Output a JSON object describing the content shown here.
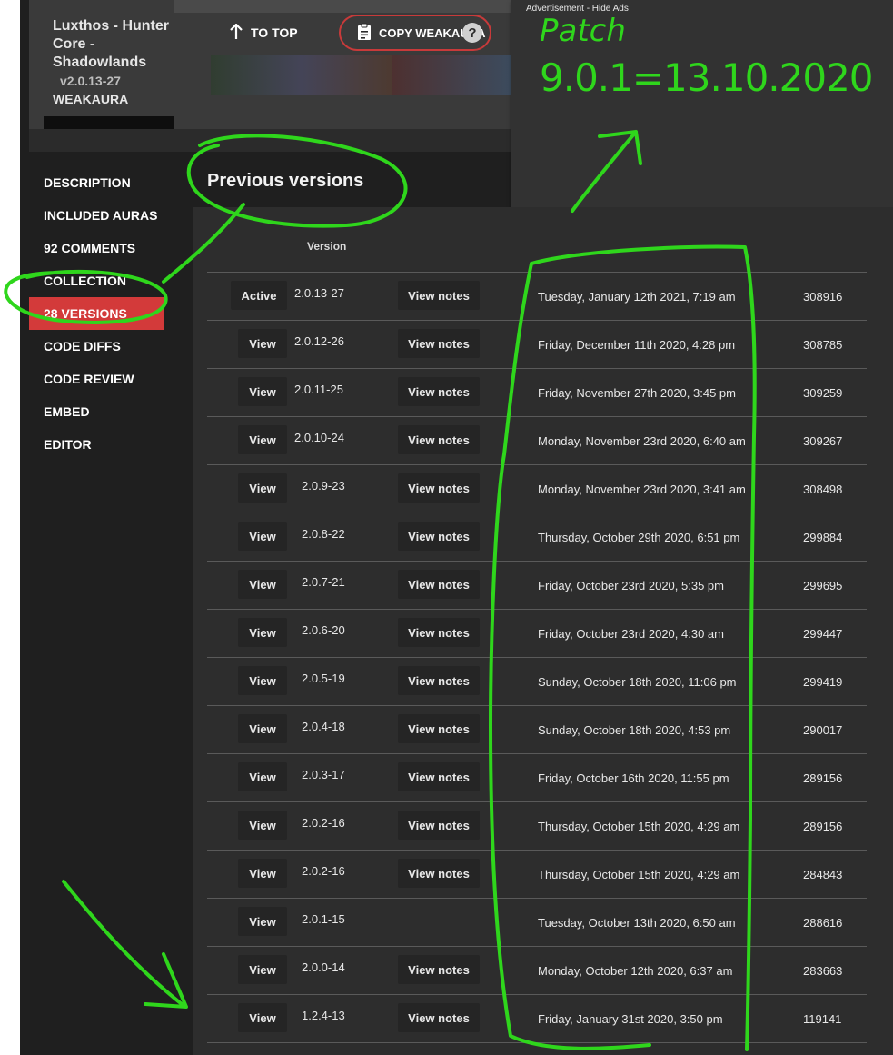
{
  "header": {
    "aura_title": "Luxthos - Hunter Core - Shadowlands",
    "aura_version": "v2.0.13-27",
    "aura_type": "WEAKAURA",
    "to_top_label": "TO TOP",
    "copy_label": "COPY WEAKAURA",
    "help_glyph": "?"
  },
  "ad": {
    "label": "Advertisement - Hide Ads"
  },
  "sidebar": {
    "items": [
      {
        "label": "DESCRIPTION"
      },
      {
        "label": "INCLUDED AURAS"
      },
      {
        "label": "92 COMMENTS"
      },
      {
        "label": "COLLECTION"
      },
      {
        "label": "28 VERSIONS"
      },
      {
        "label": "CODE DIFFS"
      },
      {
        "label": "CODE REVIEW"
      },
      {
        "label": "EMBED"
      },
      {
        "label": "EDITOR"
      }
    ],
    "active_index": 4
  },
  "main": {
    "section_title": "Previous versions",
    "column_version": "Version"
  },
  "versions": {
    "rows": [
      {
        "action": "Active",
        "version": "2.0.13-27",
        "notes": "View notes",
        "date": "Tuesday, January 12th 2021, 7:19 am",
        "id": "308916"
      },
      {
        "action": "View",
        "version": "2.0.12-26",
        "notes": "View notes",
        "date": "Friday, December 11th 2020, 4:28 pm",
        "id": "308785"
      },
      {
        "action": "View",
        "version": "2.0.11-25",
        "notes": "View notes",
        "date": "Friday, November 27th 2020, 3:45 pm",
        "id": "309259"
      },
      {
        "action": "View",
        "version": "2.0.10-24",
        "notes": "View notes",
        "date": "Monday, November 23rd 2020, 6:40 am",
        "id": "309267"
      },
      {
        "action": "View",
        "version": "2.0.9-23",
        "notes": "View notes",
        "date": "Monday, November 23rd 2020, 3:41 am",
        "id": "308498"
      },
      {
        "action": "View",
        "version": "2.0.8-22",
        "notes": "View notes",
        "date": "Thursday, October 29th 2020, 6:51 pm",
        "id": "299884"
      },
      {
        "action": "View",
        "version": "2.0.7-21",
        "notes": "View notes",
        "date": "Friday, October 23rd 2020, 5:35 pm",
        "id": "299695"
      },
      {
        "action": "View",
        "version": "2.0.6-20",
        "notes": "View notes",
        "date": "Friday, October 23rd 2020, 4:30 am",
        "id": "299447"
      },
      {
        "action": "View",
        "version": "2.0.5-19",
        "notes": "View notes",
        "date": "Sunday, October 18th 2020, 11:06 pm",
        "id": "299419"
      },
      {
        "action": "View",
        "version": "2.0.4-18",
        "notes": "View notes",
        "date": "Sunday, October 18th 2020, 4:53 pm",
        "id": "290017"
      },
      {
        "action": "View",
        "version": "2.0.3-17",
        "notes": "View notes",
        "date": "Friday, October 16th 2020, 11:55 pm",
        "id": "289156"
      },
      {
        "action": "View",
        "version": "2.0.2-16",
        "notes": "View notes",
        "date": "Thursday, October 15th 2020, 4:29 am",
        "id": "289156"
      },
      {
        "action": "View",
        "version": "2.0.2-16",
        "notes": "View notes",
        "date": "Thursday, October 15th 2020, 4:29 am",
        "id": "284843"
      },
      {
        "action": "View",
        "version": "2.0.1-15",
        "notes": "",
        "date": "Tuesday, October 13th 2020, 6:50 am",
        "id": "288616"
      },
      {
        "action": "View",
        "version": "2.0.0-14",
        "notes": "View notes",
        "date": "Monday, October 12th 2020, 6:37 am",
        "id": "283663"
      },
      {
        "action": "View",
        "version": "1.2.4-13",
        "notes": "View notes",
        "date": "Friday, January 31st 2020, 3:50 pm",
        "id": "119141"
      }
    ]
  },
  "annotation": {
    "line1": "Patch",
    "line2": "9.0.1=13.10.2020",
    "color": "#2fd61c"
  },
  "colors": {
    "accent": "#d33a3a",
    "page_bg": "#1f1f1f",
    "table_bg": "#2d2d2d"
  }
}
